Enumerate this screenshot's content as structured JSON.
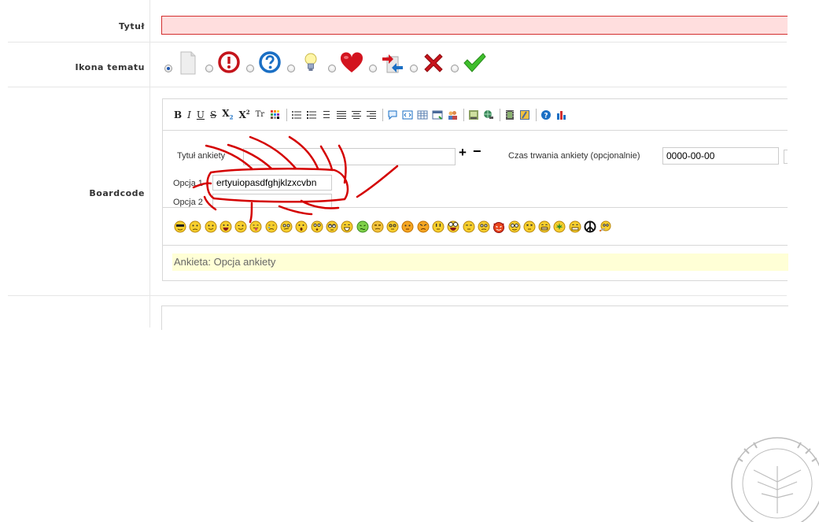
{
  "labels": {
    "title": "Tytuł",
    "topic_icon": "Ikona tematu",
    "boardcode": "Boardcode"
  },
  "title_field": {
    "value": ""
  },
  "topic_icons": [
    {
      "name": "page",
      "checked": true
    },
    {
      "name": "exclamation",
      "checked": false
    },
    {
      "name": "question",
      "checked": false
    },
    {
      "name": "lightbulb",
      "checked": false
    },
    {
      "name": "heart",
      "checked": false
    },
    {
      "name": "redirect-arrow",
      "checked": false
    },
    {
      "name": "red-x",
      "checked": false
    },
    {
      "name": "green-check",
      "checked": false
    }
  ],
  "toolbar": {
    "bold": "B",
    "italic": "I",
    "underline": "U",
    "strike": "S",
    "subscript": "X",
    "sub_mark": "2",
    "superscript": "X",
    "sup_mark": "2",
    "font": "Tr"
  },
  "poll": {
    "title_label": "Tytuł ankiety",
    "title_value": "",
    "add_label": "+",
    "remove_label": "−",
    "duration_label": "Czas trwania ankiety (opcjonalnie)",
    "duration_value": "0000-00-00",
    "option1_label": "Opcja 1",
    "option1_value": "ertyuiopasdfghjklzxcvbn",
    "option2_label": "Opcja 2",
    "option2_value": ""
  },
  "preview_text": "Ankieta: Opcja ankiety",
  "colors": {
    "error_bg": "#ffdede",
    "error_border": "#d32f2f",
    "preview_bg": "#ffffd6",
    "annotation": "#d40000"
  }
}
